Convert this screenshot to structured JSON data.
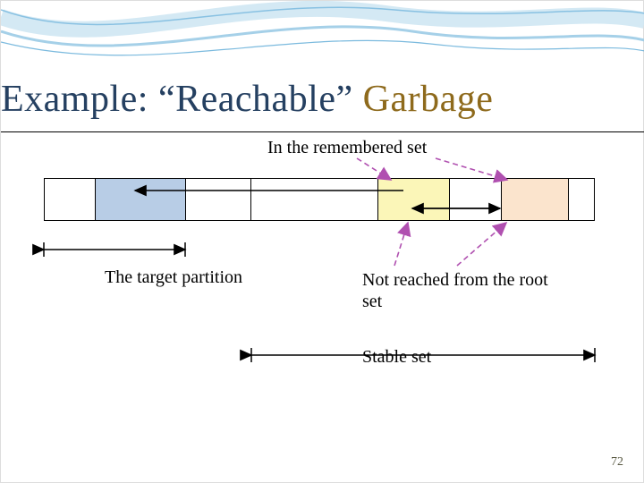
{
  "title": {
    "part1": "Example: “",
    "part2": "Reachable",
    "part3": "” ",
    "part4": "Garbage"
  },
  "labels": {
    "remembered": "In the remembered set",
    "target": "The target partition",
    "not_reached": "Not reached from the root set",
    "stable": "Stable set"
  },
  "page_number": "72",
  "chart_data": {
    "type": "table",
    "title": "Memory partition bar for generational GC example",
    "segments": [
      {
        "index": 0,
        "role": "empty",
        "color": "#ffffff"
      },
      {
        "index": 1,
        "role": "target-partition",
        "color": "#b8cde6"
      },
      {
        "index": 2,
        "role": "empty",
        "color": "#ffffff"
      },
      {
        "index": 3,
        "role": "stable-set-start",
        "color": "#ffffff"
      },
      {
        "index": 4,
        "role": "remembered-yellow",
        "color": "#fbf6b8"
      },
      {
        "index": 5,
        "role": "stable-gap",
        "color": "#ffffff"
      },
      {
        "index": 6,
        "role": "remembered-orange",
        "color": "#fbe4cd"
      },
      {
        "index": 7,
        "role": "empty",
        "color": "#ffffff"
      }
    ],
    "pointers": [
      {
        "from_segment": 4,
        "to_segment": 1,
        "style": "solid"
      },
      {
        "from_segment": 6,
        "to_segment": 4,
        "style": "solid"
      },
      {
        "from_segment": 4,
        "to_segment": 6,
        "style": "solid"
      }
    ],
    "annotations": [
      {
        "text_key": "labels.remembered",
        "targets": [
          4,
          6
        ],
        "style": "dashed"
      },
      {
        "text_key": "labels.target",
        "targets": [
          1
        ],
        "style": "solid-span"
      },
      {
        "text_key": "labels.not_reached",
        "targets": [
          4,
          6
        ],
        "style": "dashed"
      },
      {
        "text_key": "labels.stable",
        "span_segments": [
          3,
          7
        ],
        "style": "solid-span"
      }
    ]
  }
}
